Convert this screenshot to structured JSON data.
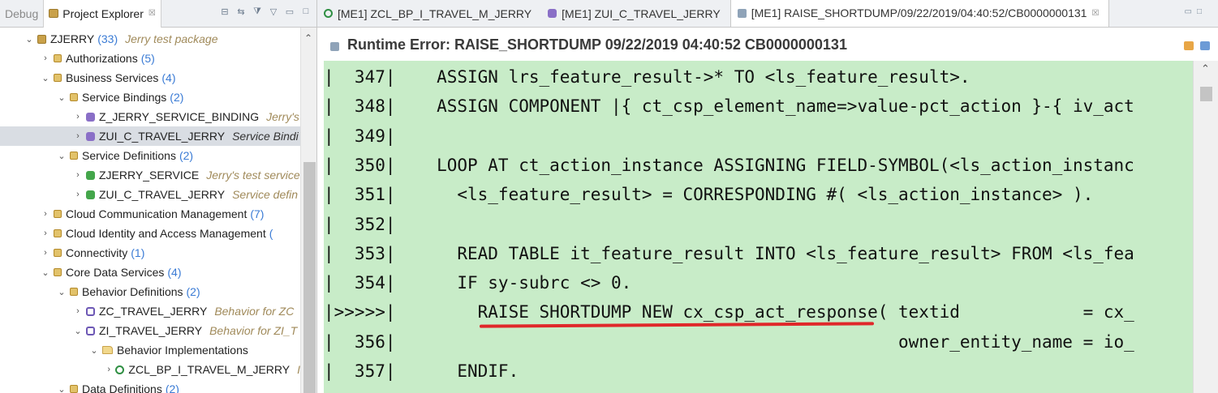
{
  "left": {
    "tabs": [
      {
        "label": "Debug"
      },
      {
        "label": "Project Explorer",
        "close": "☒"
      }
    ],
    "tree": [
      {
        "label": "ZJERRY",
        "count": "(33)",
        "desc": "Jerry test package",
        "depth": 0,
        "toggle": "open",
        "icon": "package-icon"
      },
      {
        "label": "Authorizations",
        "count": "(5)",
        "desc": "",
        "depth": 1,
        "toggle": "closed",
        "icon": "folder-package-icon"
      },
      {
        "label": "Business Services",
        "count": "(4)",
        "desc": "",
        "depth": 1,
        "toggle": "open",
        "icon": "folder-package-icon"
      },
      {
        "label": "Service Bindings",
        "count": "(2)",
        "desc": "",
        "depth": 2,
        "toggle": "open",
        "icon": "folder-package-icon"
      },
      {
        "label": "Z_JERRY_SERVICE_BINDING",
        "count": "",
        "desc": "Jerry's",
        "depth": 3,
        "toggle": "closed",
        "icon": "service-binding-icon"
      },
      {
        "label": "ZUI_C_TRAVEL_JERRY",
        "count": "",
        "desc": "Service Bindi",
        "depth": 3,
        "toggle": "closed",
        "icon": "service-binding-icon",
        "selected": true
      },
      {
        "label": "Service Definitions",
        "count": "(2)",
        "desc": "",
        "depth": 2,
        "toggle": "open",
        "icon": "folder-package-icon"
      },
      {
        "label": "ZJERRY_SERVICE",
        "count": "",
        "desc": "Jerry's test service",
        "depth": 3,
        "toggle": "closed",
        "icon": "service-definition-icon"
      },
      {
        "label": "ZUI_C_TRAVEL_JERRY",
        "count": "",
        "desc": "Service defin",
        "depth": 3,
        "toggle": "closed",
        "icon": "service-definition-icon"
      },
      {
        "label": "Cloud Communication Management",
        "count": "(7)",
        "desc": "",
        "depth": 1,
        "toggle": "closed",
        "icon": "folder-package-icon"
      },
      {
        "label": "Cloud Identity and Access Management",
        "count": "(",
        "desc": "",
        "depth": 1,
        "toggle": "closed",
        "icon": "folder-package-icon"
      },
      {
        "label": "Connectivity",
        "count": "(1)",
        "desc": "",
        "depth": 1,
        "toggle": "closed",
        "icon": "folder-package-icon"
      },
      {
        "label": "Core Data Services",
        "count": "(4)",
        "desc": "",
        "depth": 1,
        "toggle": "open",
        "icon": "folder-package-icon"
      },
      {
        "label": "Behavior Definitions",
        "count": "(2)",
        "desc": "",
        "depth": 2,
        "toggle": "open",
        "icon": "folder-package-icon"
      },
      {
        "label": "ZC_TRAVEL_JERRY",
        "count": "",
        "desc": "Behavior for ZC",
        "depth": 3,
        "toggle": "closed",
        "icon": "behavior-definition-icon"
      },
      {
        "label": "ZI_TRAVEL_JERRY",
        "count": "",
        "desc": "Behavior for ZI_T",
        "depth": 3,
        "toggle": "open",
        "icon": "behavior-definition-icon"
      },
      {
        "label": "Behavior Implementations",
        "count": "",
        "desc": "",
        "depth": 4,
        "toggle": "open",
        "icon": "open-folder-icon"
      },
      {
        "label": "ZCL_BP_I_TRAVEL_M_JERRY",
        "count": "",
        "desc": "I",
        "depth": 5,
        "toggle": "closed",
        "icon": "abap-class-icon"
      },
      {
        "label": "Data Definitions",
        "count": "(2)",
        "desc": "",
        "depth": 2,
        "toggle": "open",
        "icon": "folder-package-icon"
      }
    ]
  },
  "editor": {
    "tabs": [
      {
        "label": "[ME1] ZCL_BP_I_TRAVEL_M_JERRY",
        "icon": "abap-class-icon"
      },
      {
        "label": "[ME1] ZUI_C_TRAVEL_JERRY",
        "icon": "service-binding-icon"
      },
      {
        "label": "[ME1] RAISE_SHORTDUMP/09/22/2019/04:40:52/CB0000000131",
        "icon": "runtime-error-icon",
        "active": true,
        "close": "☒"
      }
    ],
    "title": "Runtime Error: RAISE_SHORTDUMP 09/22/2019 04:40:52 CB0000000131",
    "code_lines": [
      "|  347|    ASSIGN lrs_feature_result->* TO <ls_feature_result>.",
      "|  348|    ASSIGN COMPONENT |{ ct_csp_element_name=>value-pct_action }-{ iv_act",
      "|  349|",
      "|  350|    LOOP AT ct_action_instance ASSIGNING FIELD-SYMBOL(<ls_action_instanc",
      "|  351|      <ls_feature_result> = CORRESPONDING #( <ls_action_instance> ).",
      "|  352|",
      "|  353|      READ TABLE it_feature_result INTO <ls_feature_result> FROM <ls_fea",
      "|  354|      IF sy-subrc <> 0.",
      "|>>>>>|        RAISE SHORTDUMP NEW cx_csp_act_response( textid            = cx_",
      "|  356|                                                 owner_entity_name = io_",
      "|  357|      ENDIF."
    ],
    "highlight_color": "#c8ecc8",
    "underline_color": "#e0272a"
  }
}
